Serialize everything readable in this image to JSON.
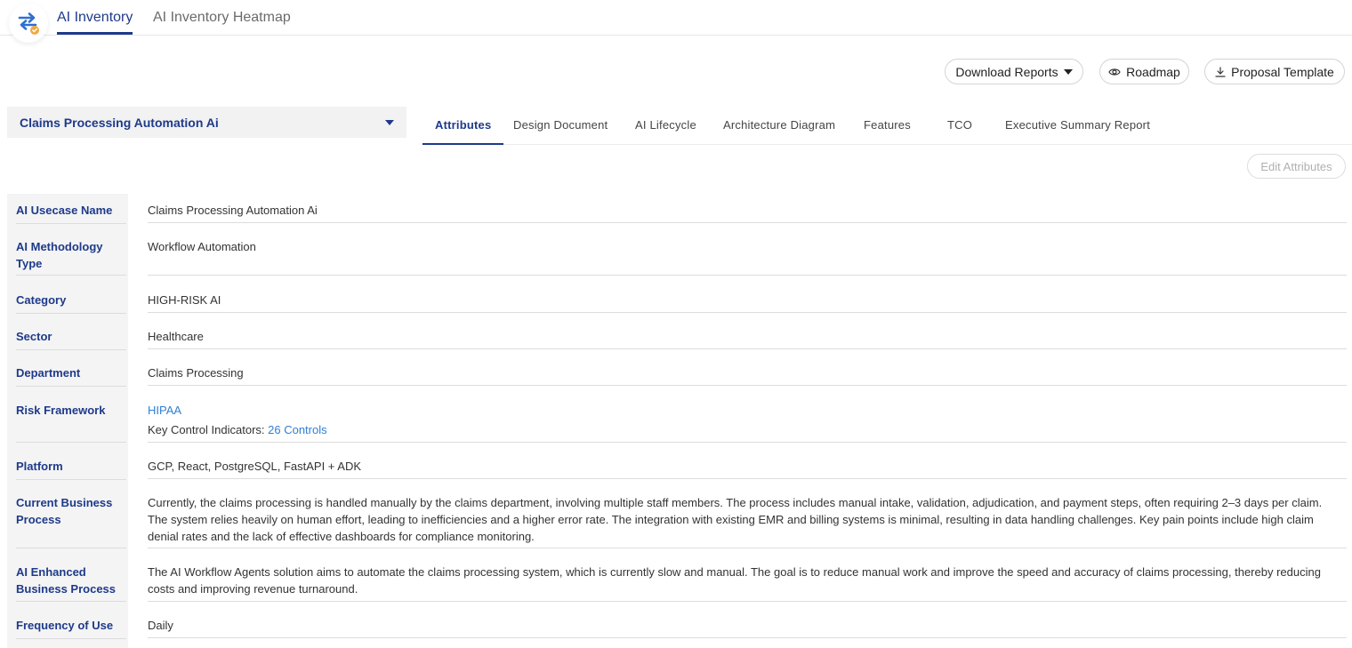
{
  "nav": {
    "tabs": [
      {
        "label": "AI Inventory",
        "active": true
      },
      {
        "label": "AI Inventory Heatmap",
        "active": false
      }
    ]
  },
  "actions": {
    "download_label": "Download Reports",
    "roadmap_label": "Roadmap",
    "proposal_label": "Proposal Template"
  },
  "usecase_select": {
    "value": "Claims Processing Automation Ai"
  },
  "detail_tabs": [
    {
      "label": "Attributes",
      "active": true
    },
    {
      "label": "Design Document",
      "active": false
    },
    {
      "label": "AI Lifecycle",
      "active": false
    },
    {
      "label": "Architecture Diagram",
      "active": false
    },
    {
      "label": "Features",
      "active": false
    },
    {
      "label": "TCO",
      "active": false
    },
    {
      "label": "Executive Summary Report",
      "active": false
    }
  ],
  "edit_attributes_label": "Edit Attributes",
  "attributes": {
    "usecase_name": {
      "label": "AI Usecase Name",
      "value": "Claims Processing Automation Ai"
    },
    "methodology": {
      "label": "AI Methodology Type",
      "value": "Workflow Automation"
    },
    "category": {
      "label": "Category",
      "value": "HIGH-RISK AI"
    },
    "sector": {
      "label": "Sector",
      "value": "Healthcare"
    },
    "department": {
      "label": "Department",
      "value": "Claims Processing"
    },
    "risk_framework": {
      "label": "Risk Framework",
      "framework_link": "HIPAA",
      "kci_label": "Key Control Indicators: ",
      "kci_link": "26 Controls"
    },
    "platform": {
      "label": "Platform",
      "value": "GCP, React, PostgreSQL, FastAPI + ADK"
    },
    "current_process": {
      "label": "Current Business Process",
      "value": "Currently, the claims processing is handled manually by the claims department, involving multiple staff members. The process includes manual intake, validation, adjudication, and payment steps, often requiring 2–3 days per claim. The system relies heavily on human effort, leading to inefficiencies and a higher error rate. The integration with existing EMR and billing systems is minimal, resulting in data handling challenges. Key pain points include high claim denial rates and the lack of effective dashboards for compliance monitoring."
    },
    "enhanced_process": {
      "label": "AI Enhanced Business Process",
      "value": "The AI Workflow Agents solution aims to automate the claims processing system, which is currently slow and manual. The goal is to reduce manual work and improve the speed and accuracy of claims processing, thereby reducing costs and improving revenue turnaround."
    },
    "frequency": {
      "label": "Frequency of Use",
      "value": "Daily"
    }
  },
  "colors": {
    "accent": "#1e3a8a",
    "link": "#2f7fd3",
    "logo_orange": "#f2a73b"
  },
  "icons": {
    "logo": "sync-arrows-logo-icon",
    "download_caret": "caret-down-icon",
    "roadmap": "eye-icon",
    "proposal": "download-icon",
    "select_caret": "caret-down-icon"
  }
}
